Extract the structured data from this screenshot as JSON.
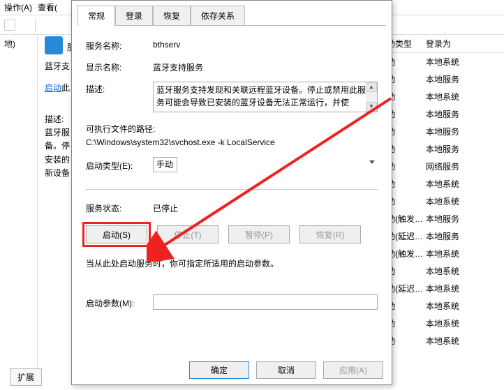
{
  "bg": {
    "menu": {
      "action": "操作(A)",
      "view": "查看("
    },
    "sidebarLabel": "地)",
    "extTab": "扩展",
    "detail": {
      "title": "蓝牙支",
      "startLink": "启动",
      "startSuffix": "此",
      "descLabel": "描述:",
      "desc1": "蓝牙服",
      "desc2": "备。停",
      "desc3": "安装的",
      "desc4": "新设备"
    },
    "columns": {
      "startType": "动类型",
      "logonAs": "登录为"
    },
    "rows": [
      {
        "c1": "动",
        "c2": "本地系统"
      },
      {
        "c1": "动",
        "c2": "本地服务"
      },
      {
        "c1": "动",
        "c2": "本地系统"
      },
      {
        "c1": "动",
        "c2": "本地服务"
      },
      {
        "c1": "动",
        "c2": "本地服务"
      },
      {
        "c1": "动",
        "c2": "本地服务"
      },
      {
        "c1": "动",
        "c2": "网络服务"
      },
      {
        "c1": "动",
        "c2": "本地系统"
      },
      {
        "c1": "动",
        "c2": "本地系统"
      },
      {
        "c1": "动(触发…",
        "c2": "本地服务"
      },
      {
        "c1": "动(延迟…",
        "c2": "本地服务"
      },
      {
        "c1": "动(触发…",
        "c2": "本地系统"
      },
      {
        "c1": "动",
        "c2": "本地系统"
      },
      {
        "c1": "动(延迟…",
        "c2": "本地系统"
      },
      {
        "c1": "动",
        "c2": "本地系统"
      },
      {
        "c1": "动",
        "c2": "本地系统"
      },
      {
        "c1": "动",
        "c2": "本地系统"
      }
    ]
  },
  "dialog": {
    "tabs": {
      "general": "常规",
      "logon": "登录",
      "recovery": "恢复",
      "deps": "依存关系"
    },
    "serviceNameLabel": "服务名称:",
    "serviceName": "bthserv",
    "displayNameLabel": "显示名称:",
    "displayName": "蓝牙支持服务",
    "descLabel": "描述:",
    "desc": "蓝牙服务支持发现和关联远程蓝牙设备。停止或禁用此服务可能会导致已安装的蓝牙设备无法正常运行，并使",
    "pathLabel": "可执行文件的路径:",
    "path": "C:\\Windows\\system32\\svchost.exe -k LocalService",
    "startTypeLabel": "启动类型(E):",
    "startType": "手动",
    "statusLabel": "服务状态:",
    "status": "已停止",
    "btnStart": "启动(S)",
    "btnStop": "停止(T)",
    "btnPause": "暂停(P)",
    "btnResume": "恢复(R)",
    "hint": "当从此处启动服务时，你可指定所适用的启动参数。",
    "paramLabel": "启动参数(M):",
    "ok": "确定",
    "cancel": "取消",
    "apply": "应用(A)"
  }
}
